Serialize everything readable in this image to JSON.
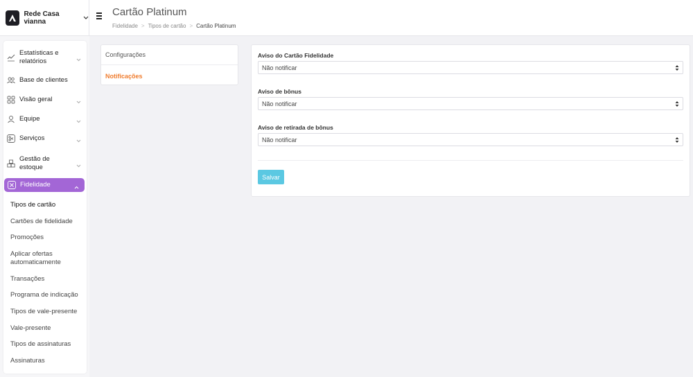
{
  "brand": {
    "name": "Rede Casa vianna"
  },
  "header": {
    "title": "Cartão Platinum",
    "breadcrumb": [
      "Fidelidade",
      "Tipos de cartão",
      "Cartão Platinum"
    ]
  },
  "sidebar": {
    "items": [
      {
        "label": "Estatísticas e relatórios",
        "icon": "chart-icon",
        "chevron": true
      },
      {
        "label": "Base de clientes",
        "icon": "users-icon",
        "chevron": false
      },
      {
        "label": "Visão geral",
        "icon": "grid-icon",
        "chevron": true
      },
      {
        "label": "Equipe",
        "icon": "user-icon",
        "chevron": true
      },
      {
        "label": "Serviços",
        "icon": "scissors-icon",
        "chevron": true
      },
      {
        "label": "Gestão de estoque",
        "icon": "boxes-icon",
        "chevron": true
      },
      {
        "label": "Fidelidade",
        "icon": "loyalty-icon",
        "chevron": true,
        "active": true
      }
    ],
    "subitems": [
      "Tipos de cartão",
      "Cartões de fidelidade",
      "Promoções",
      "Aplicar ofertas automaticamente",
      "Transações",
      "Programa de indicação",
      "Tipos de vale-presente",
      "Vale-presente",
      "Tipos de assinaturas",
      "Assinaturas"
    ],
    "current_subitem": "Tipos de cartão",
    "active_color": "#a366d6"
  },
  "tabs": {
    "items": [
      "Configurações",
      "Notificações"
    ],
    "active": "Notificações",
    "active_color": "#f07d2f"
  },
  "form": {
    "fields": [
      {
        "label": "Aviso do Cartão Fidelidade",
        "value": "Não notificar"
      },
      {
        "label": "Aviso de bônus",
        "value": "Não notificar"
      },
      {
        "label": "Aviso de retirada de bônus",
        "value": "Não notificar"
      }
    ],
    "save_label": "Salvar",
    "save_color": "#5bc8e2"
  }
}
